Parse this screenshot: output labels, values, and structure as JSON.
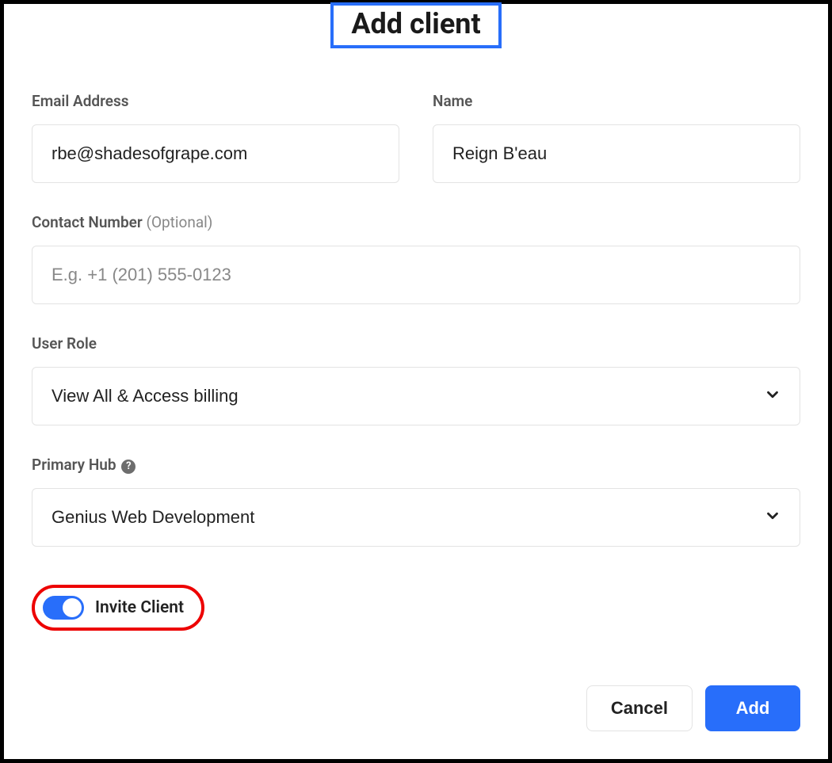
{
  "dialog": {
    "title": "Add client"
  },
  "fields": {
    "email": {
      "label": "Email Address",
      "value": "rbe@shadesofgrape.com"
    },
    "name": {
      "label": "Name",
      "value": "Reign B'eau"
    },
    "contact": {
      "label": "Contact Number",
      "optional_text": "(Optional)",
      "placeholder": "E.g. +1 (201) 555-0123",
      "value": ""
    },
    "role": {
      "label": "User Role",
      "value": "View All & Access billing"
    },
    "hub": {
      "label": "Primary Hub",
      "value": "Genius Web Development"
    }
  },
  "invite": {
    "label": "Invite Client",
    "enabled": true
  },
  "actions": {
    "cancel": "Cancel",
    "add": "Add"
  },
  "icons": {
    "help": "?"
  }
}
